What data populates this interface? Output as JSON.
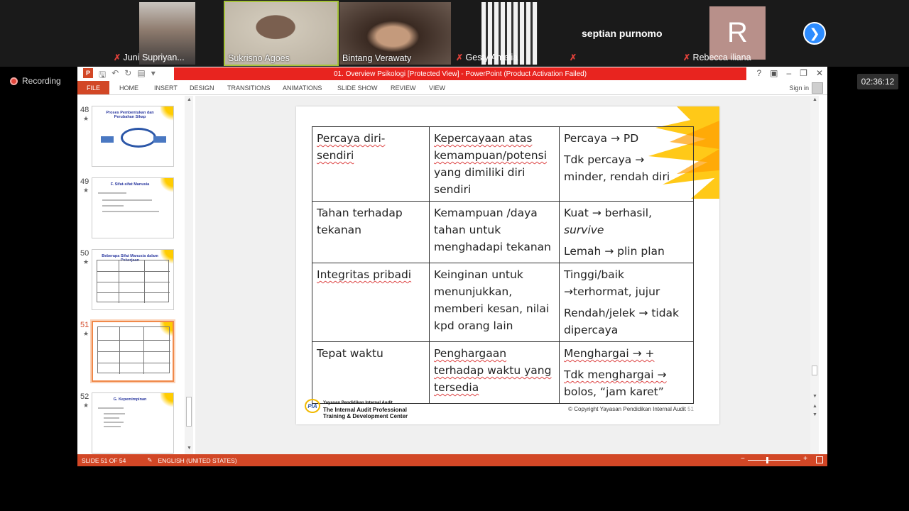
{
  "participants": [
    {
      "name": "Juni Supriyan...",
      "muted": true,
      "bg": "#5b6a7a"
    },
    {
      "name": "Sukrisno Agoes",
      "muted": false,
      "bg": "#b9b0a0"
    },
    {
      "name": "Bintang Verawaty",
      "muted": false,
      "bg": "#6b5a50"
    },
    {
      "name": "Gesty Amalia",
      "muted": true,
      "bg": "#d8d2cc"
    }
  ],
  "namecard": "septian purnomo",
  "rebecca": {
    "initial": "R",
    "name": "Rebecca iliana"
  },
  "recording_label": "Recording",
  "clock": "02:36:12",
  "ppt": {
    "title": "01. Overview Psikologi [Protected View] - PowerPoint (Product Activation Failed)",
    "tabs": [
      "FILE",
      "HOME",
      "INSERT",
      "DESIGN",
      "TRANSITIONS",
      "ANIMATIONS",
      "SLIDE SHOW",
      "REVIEW",
      "VIEW"
    ],
    "sign_in": "Sign in",
    "window_controls": [
      "?",
      "▣",
      "–",
      "❐",
      "✕"
    ],
    "status_slide": "SLIDE 51 OF 54",
    "status_lang": "ENGLISH (UNITED STATES)"
  },
  "thumbnails": [
    {
      "num": "48",
      "title": "Proses Pembentukan dan Perubahan Sikap"
    },
    {
      "num": "49",
      "title": "F. Sifat-sifat Manusia"
    },
    {
      "num": "50",
      "title": "Beberapa Sifat Manusia dalam Pekerjaan"
    },
    {
      "num": "51",
      "title": ""
    },
    {
      "num": "52",
      "title": "G. Kepemimpinan"
    }
  ],
  "slide": {
    "rows": [
      {
        "c1": [
          "Percaya diri-",
          "sendiri"
        ],
        "c2": [
          "Kepercayaan atas",
          "kemampuan/potensi",
          "yang dimiliki diri",
          "sendiri"
        ],
        "c3": [
          "Percaya → PD",
          "Tdk percaya →",
          "minder, rendah diri"
        ]
      },
      {
        "c1": [
          "Tahan terhadap",
          "tekanan"
        ],
        "c2": [
          "Kemampuan /daya",
          "tahan untuk",
          "menghadapi tekanan"
        ],
        "c3": [
          "Kuat → berhasil,",
          "survive",
          "Lemah → plin plan"
        ]
      },
      {
        "c1": [
          "Integritas pribadi"
        ],
        "c2": [
          "Keinginan untuk",
          "menunjukkan,",
          "memberi kesan, nilai",
          "kpd orang lain"
        ],
        "c3": [
          "Tinggi/baik",
          "→terhormat, jujur",
          "Rendah/jelek → tidak",
          "dipercaya"
        ]
      },
      {
        "c1": [
          "Tepat waktu"
        ],
        "c2": [
          "Penghargaan",
          "terhadap waktu yang",
          "tersedia"
        ],
        "c3": [
          "Menghargai → +",
          "Tdk menghargai →",
          "bolos,  “jam karet”"
        ]
      }
    ],
    "logo_line1": "Yayasan Pendidikan Internal Audit",
    "logo_line2": "The Internal Audit Professional",
    "logo_line3": "Training & Development Center",
    "logo_badge": "PIA",
    "copyright": "© Copyright  Yayasan Pendidikan Internal Audit",
    "page": "51"
  }
}
